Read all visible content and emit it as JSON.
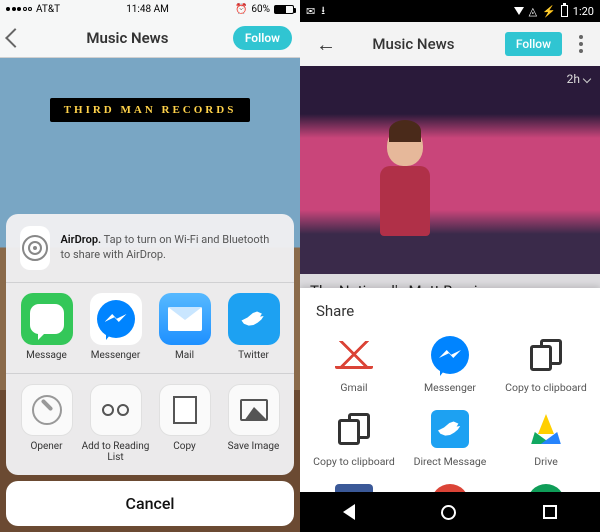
{
  "ios": {
    "status": {
      "carrier": "AT&T",
      "time": "11:48 AM",
      "battery_pct": "60%",
      "alarm": "⏰"
    },
    "nav": {
      "title": "Music News",
      "follow": "Follow"
    },
    "bg": {
      "sign": "THIRD MAN RECORDS"
    },
    "sheet": {
      "airdrop": {
        "title": "AirDrop.",
        "body": "Tap to turn on Wi-Fi and Bluetooth to share with AirDrop."
      },
      "apps": [
        {
          "name": "Message",
          "color": "#34c759"
        },
        {
          "name": "Messenger",
          "color": "#0084ff"
        },
        {
          "name": "Mail",
          "color": "#1ea0ff"
        },
        {
          "name": "Twitter",
          "color": "#1da1f2"
        }
      ],
      "actions": [
        {
          "name": "Opener"
        },
        {
          "name": "Add to Reading List"
        },
        {
          "name": "Copy"
        },
        {
          "name": "Save Image"
        }
      ],
      "cancel": "Cancel"
    }
  },
  "android": {
    "status": {
      "time": "1:20"
    },
    "nav": {
      "title": "Music News",
      "follow": "Follow"
    },
    "article": {
      "age": "2h",
      "headline": "The National's Matt Berninger:"
    },
    "sheet": {
      "title": "Share",
      "apps": [
        {
          "name": "Gmail"
        },
        {
          "name": "Messenger"
        },
        {
          "name": "Copy to clipboard"
        },
        {
          "name": "Copy to clipboard"
        },
        {
          "name": "Direct Message"
        },
        {
          "name": "Drive"
        },
        {
          "name": ""
        },
        {
          "name": ""
        },
        {
          "name": ""
        }
      ]
    }
  }
}
